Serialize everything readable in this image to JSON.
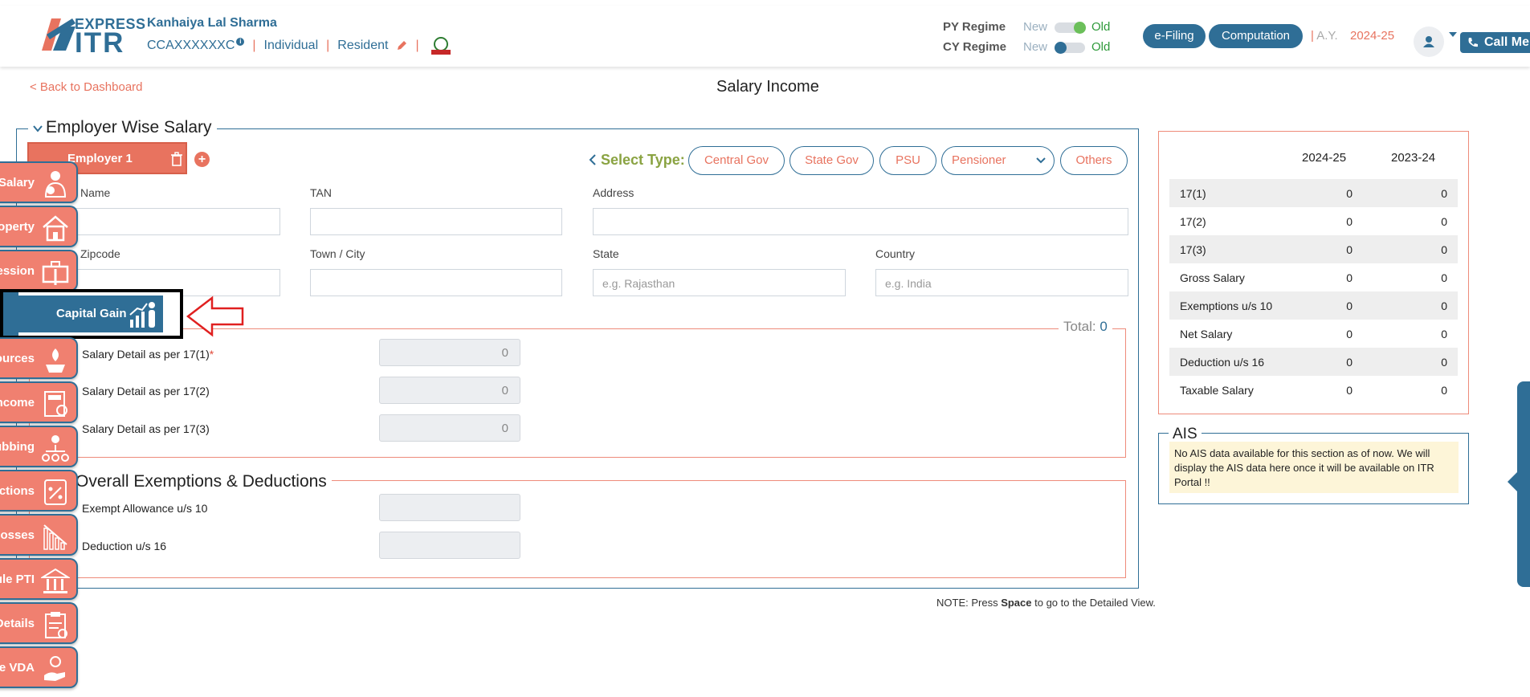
{
  "header": {
    "logo_small": "EXPRESS",
    "logo_big": "ITR",
    "user_name": "Kanhaiya Lal Sharma",
    "pan": "CCAXXXXXXC",
    "info_glyph": "i",
    "status": "Individual",
    "residency": "Resident",
    "py_regime_label": "PY Regime",
    "cy_regime_label": "CY Regime",
    "new_label": "New",
    "old_label": "Old",
    "efiling_label": "e-Filing",
    "computation_label": "Computation",
    "ay_label": "A.Y.",
    "ay_value": "2024-25",
    "call_label": "Call Me",
    "separator": "|"
  },
  "page": {
    "back_link": "< Back to Dashboard",
    "title": "Salary Income",
    "note_prefix": "NOTE: Press ",
    "note_key": "Space",
    "note_suffix": " to go to the Detailed View."
  },
  "employer": {
    "section_title": "Employer Wise Salary",
    "tab_label": "Employer 1",
    "add_glyph": "+",
    "select_type_label": "Select Type:",
    "types": [
      "Central Gov",
      "State Gov",
      "PSU",
      "Pensioner",
      "Others"
    ],
    "fields": {
      "name_label": "Name",
      "tan_label": "TAN",
      "address_label": "Address",
      "zipcode_label": "Zipcode",
      "town_label": "Town / City",
      "state_label": "State",
      "state_placeholder": "e.g. Rajasthan",
      "country_label": "Country",
      "country_placeholder": "e.g. India"
    },
    "total_label": "Total: ",
    "total_value": "0",
    "salary_rows": [
      {
        "label": "Salary Detail as per 17(1)",
        "required": "*",
        "value": "0"
      },
      {
        "label": "Salary Detail as per 17(2)",
        "value": "0"
      },
      {
        "label": "Salary Detail as per 17(3)",
        "value": "0"
      }
    ],
    "exemptions_title": "Overall Exemptions & Deductions",
    "exemption_rows": [
      {
        "label": "Exempt Allowance u/s 10",
        "value": ""
      },
      {
        "label": "Deduction u/s 16",
        "value": ""
      }
    ]
  },
  "summary": {
    "headers": [
      "2024-25",
      "2023-24"
    ],
    "rows": [
      {
        "label": "17(1)",
        "cy": "0",
        "py": "0"
      },
      {
        "label": "17(2)",
        "cy": "0",
        "py": "0"
      },
      {
        "label": "17(3)",
        "cy": "0",
        "py": "0"
      },
      {
        "label": "Gross Salary",
        "cy": "0",
        "py": "0"
      },
      {
        "label": "Exemptions u/s 10",
        "cy": "0",
        "py": "0"
      },
      {
        "label": "Net Salary",
        "cy": "0",
        "py": "0"
      },
      {
        "label": "Deduction u/s 16",
        "cy": "0",
        "py": "0"
      },
      {
        "label": "Taxable Salary",
        "cy": "0",
        "py": "0"
      }
    ]
  },
  "ais": {
    "title": "AIS",
    "message": "No AIS data available for this section as of now. We will display the AIS data here once it will be available on ITR Portal !!"
  },
  "side_menu": [
    {
      "label": "Salary",
      "icon": "salary-person-icon"
    },
    {
      "label": "operty",
      "icon": "house-icon"
    },
    {
      "label": "fession",
      "icon": "briefcase-icon"
    },
    {
      "label": "Capital Gain",
      "icon": "growth-chart-person-icon"
    },
    {
      "label": "ources",
      "icon": "hand-flame-icon"
    },
    {
      "label": "ncome",
      "icon": "tax-calculator-icon"
    },
    {
      "label": "ubbing",
      "icon": "family-tree-icon"
    },
    {
      "label": "uctions",
      "icon": "tax-percent-icon"
    },
    {
      "label": "Losses",
      "icon": "declining-chart-icon"
    },
    {
      "label": "ule PTI",
      "icon": "bank-cross-icon"
    },
    {
      "label": "Details",
      "icon": "tax-clipboard-icon"
    },
    {
      "label": "ule VDA",
      "icon": "crypto-hand-icon"
    }
  ],
  "colors": {
    "primary": "#2f6e96",
    "accent": "#e8735f",
    "green": "#2e9a3a"
  }
}
